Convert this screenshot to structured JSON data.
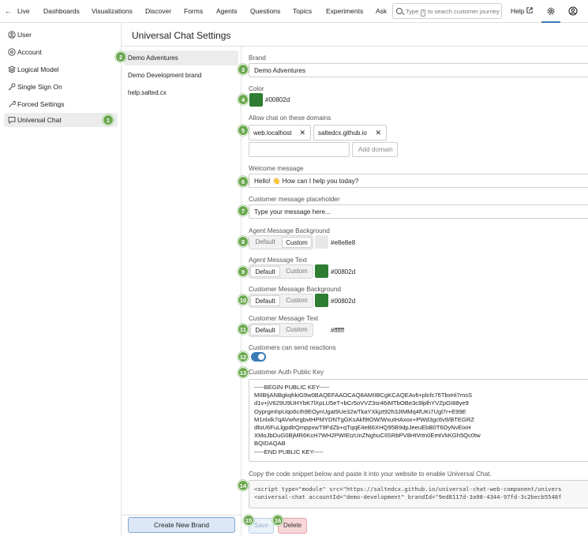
{
  "nav": {
    "back": "←",
    "items": [
      "Live",
      "Dashboards",
      "Visualizations",
      "Discover",
      "Forms",
      "Agents",
      "Questions",
      "Topics",
      "Experiments",
      "Ask"
    ],
    "search_pre": "Type",
    "search_key": "/",
    "search_post": "to search customer journey",
    "help": "Help"
  },
  "sidebar": {
    "items": [
      {
        "label": "User",
        "icon": "user-circle-icon"
      },
      {
        "label": "Account",
        "icon": "account-icon"
      },
      {
        "label": "Logical Model",
        "icon": "layers-icon"
      },
      {
        "label": "Single Sign On",
        "icon": "key-icon"
      },
      {
        "label": "Forced Settings",
        "icon": "wrench-icon"
      },
      {
        "label": "Universal Chat",
        "icon": "chat-icon"
      }
    ]
  },
  "page": {
    "title": "Universal Chat Settings"
  },
  "brands": {
    "items": [
      "Demo Adventures",
      "Demo Development brand",
      "help.salted.cx"
    ],
    "new_button": "Create New Brand"
  },
  "form": {
    "brand_label": "Brand",
    "brand_value": "Demo Adventures",
    "color_label": "Color",
    "color_value": "#00802d",
    "domains_label": "Allow chat on these domains",
    "domains": [
      "web.localhost",
      "saltedcx.github.io"
    ],
    "chip_remove": "✕",
    "add_domain": "Add domain",
    "welcome_label": "Welcome message",
    "welcome_value": "Hello! 👋 How can I help you today?",
    "placeholder_label": "Customer message placeholder",
    "placeholder_value": "Type your message here...",
    "seg_default": "Default",
    "seg_custom": "Custom",
    "agent_bg_label": "Agent Message Background",
    "agent_bg_value": "#e8e8e8",
    "agent_text_label": "Agent Message Text",
    "agent_text_value": "#00802d",
    "cust_bg_label": "Customer Message Background",
    "cust_bg_value": "#00802d",
    "cust_text_label": "Customer Message Text",
    "cust_text_value": "#ffffff",
    "reactions_label": "Customers can send reactions",
    "key_label": "Customer Auth Public Key",
    "key_value": "-----BEGIN PUBLIC KEY-----\nMIIBIjANBgkqhkiG9w0BAQEFAAOCAQ8AMIIBCgKCAQEAvlt+plcfc76TbxHi7msS\nd1v+jV629U9UHYbK7lXpLU5eT+bCr5oVVZ3sr46iMTbOBe3c9lplhYVZpGI88ye9\nOyprgmhpUqo6cIh9EOynUgat9Ue32wTkaYXkjzt92h3JtMMq4fUKi7Ugl7r+E99E\nM1nlxlk7qAVwfvrgbvtHPMYDNTgGKsAkf9tOW/WxutHAxox+PWd3gc6v9/BTEGRZ\ndfoU6FuLlgpdlrQmppxwT9FdZb+qTqqE4eB6XHQ95B9dpJeeuEbB0T6OyNvEixH\nXMoJbDuG0BjMR6KcH7WH2PWIEtzUnZNghuCIlSRbPV8HtVrtn0EmtVkKGh5Qc0tw\nBQIDAQAB\n-----END PUBLIC KEY-----",
    "snippet_label": "Copy the code snippet below and paste it into your website to enable Universal Chat.",
    "snippet_line1": "<script type=\"module\" src=\"https://saltedcx.github.io/universal-chat-web-component/univers",
    "snippet_line2": "<universal-chat accountId=\"demo-development\" brandId=\"9ed8117d-3a98-4344-97fd-3c2becb5548f",
    "save": "Save",
    "delete": "Delete"
  },
  "badges": [
    "1",
    "2",
    "3",
    "4",
    "5",
    "6",
    "7",
    "8",
    "9",
    "10",
    "11",
    "12",
    "13",
    "14",
    "15",
    "16"
  ],
  "colors": {
    "accent": "#3a7ab8",
    "green": "#2e7d32",
    "badge": "#6aa84f",
    "delete_bg": "#f8d7da"
  }
}
